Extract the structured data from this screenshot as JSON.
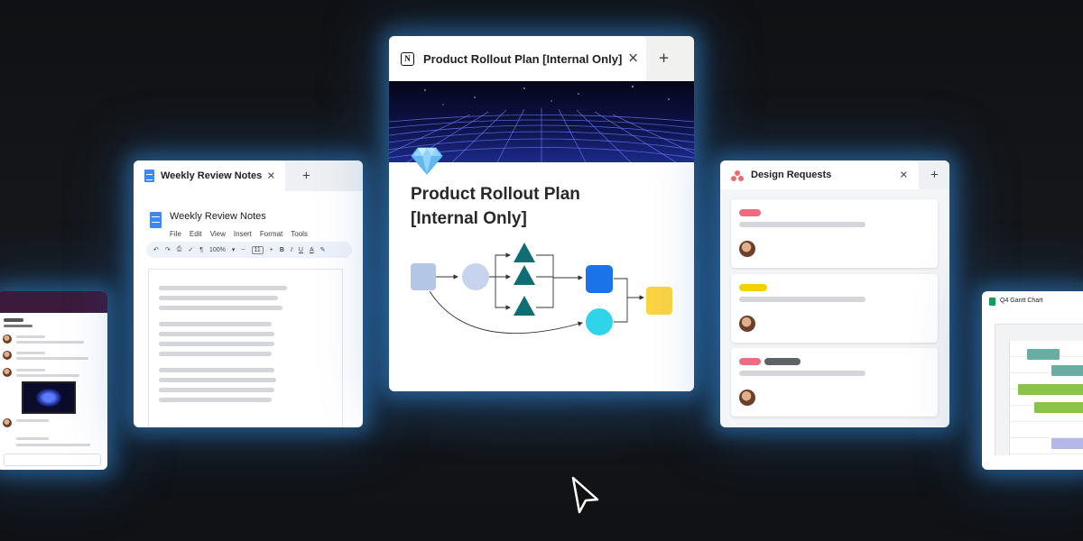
{
  "doc_window": {
    "tab_title": "Weekly Review Notes",
    "doc_title": "Weekly Review Notes",
    "menu": [
      "File",
      "Edit",
      "View",
      "Insert",
      "Format",
      "Tools"
    ],
    "zoom": "100%",
    "font_size": "11",
    "text_color_label": "A"
  },
  "notion_window": {
    "tab_title": "Product Rollout Plan [Internal Only]",
    "page_title_line1": "Product Rollout Plan",
    "page_title_line2": "[Internal Only]"
  },
  "asana_window": {
    "tab_title": "Design Requests",
    "pill_colors": [
      "#f06a80",
      "#f5d000",
      "#f06a80",
      "#5f6368"
    ]
  },
  "gantt_window": {
    "title": "Q4 Gantt Chart",
    "bar_colors": [
      "#6aaea3",
      "#8bc34a",
      "#b4b7e8"
    ]
  },
  "tab_icons": {
    "close": "×",
    "new_tab": "+"
  }
}
